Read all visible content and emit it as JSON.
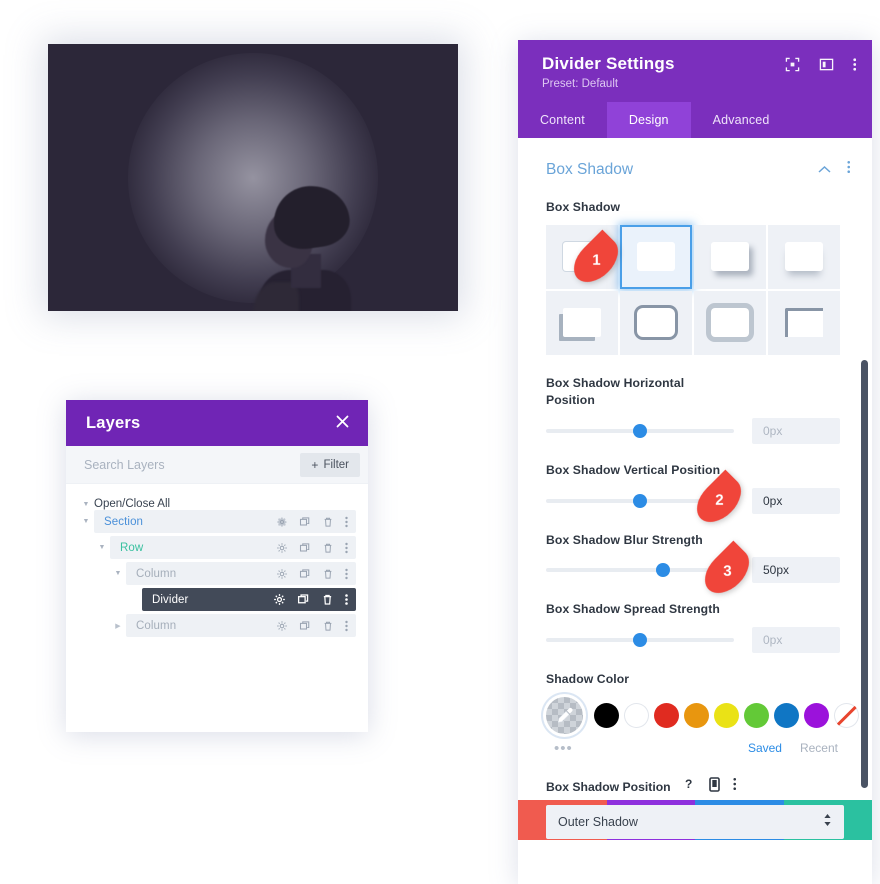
{
  "canvas": {
    "name": "divider-preview-canvas",
    "background_color": "#2c2739",
    "glow_color": "#ebebf5"
  },
  "layers_panel": {
    "title": "Layers",
    "close_icon": "close-icon",
    "search_placeholder": "Search Layers",
    "search_value": "",
    "filter_label": "Filter",
    "filter_icon": "plus-icon",
    "open_close_all": "Open/Close All",
    "row_icons": [
      "gear-icon",
      "duplicate-icon",
      "trash-icon",
      "kebab-icon"
    ],
    "rows": [
      {
        "label": "Section",
        "depth": 0,
        "caret": "down",
        "selected": false,
        "color": "#4a90d9"
      },
      {
        "label": "Row",
        "depth": 1,
        "caret": "down",
        "selected": false,
        "color": "#3ac1a0"
      },
      {
        "label": "Column",
        "depth": 2,
        "caret": "down",
        "selected": false,
        "color": "#a5aeba"
      },
      {
        "label": "Divider",
        "depth": 3,
        "caret": "none",
        "selected": true,
        "color": "#ffffff"
      },
      {
        "label": "Column",
        "depth": 2,
        "caret": "right",
        "selected": false,
        "color": "#a5aeba"
      }
    ]
  },
  "settings_panel": {
    "title": "Divider Settings",
    "preset": "Preset: Default",
    "header_icons": [
      "focus-icon",
      "layout-panel-icon",
      "kebab-icon"
    ],
    "tabs": [
      {
        "label": "Content",
        "active": false
      },
      {
        "label": "Design",
        "active": true
      },
      {
        "label": "Advanced",
        "active": false
      }
    ],
    "section": {
      "title": "Box Shadow",
      "collapse_icon": "chevron-up-icon",
      "menu_icon": "kebab-icon"
    },
    "box_shadow": {
      "label": "Box Shadow",
      "selected_index": 1,
      "presets": [
        "none-preset",
        "glow-preset",
        "offset-preset",
        "bottom-preset",
        "corner-preset",
        "outline-preset",
        "soft-preset",
        "top-left-preset"
      ]
    },
    "fields": [
      {
        "label": "Box Shadow Horizontal Position",
        "value": "0px",
        "filled": false,
        "thumb_pct": 50
      },
      {
        "label": "Box Shadow Vertical Position",
        "value": "0px",
        "filled": true,
        "thumb_pct": 50
      },
      {
        "label": "Box Shadow Blur Strength",
        "value": "50px",
        "filled": true,
        "thumb_pct": 62
      },
      {
        "label": "Box Shadow Spread Strength",
        "value": "0px",
        "filled": false,
        "thumb_pct": 50
      }
    ],
    "shadow_color": {
      "label": "Shadow Color",
      "picker_icon": "eyedropper-icon",
      "swatches": [
        {
          "name": "black",
          "hex": "#000000"
        },
        {
          "name": "white",
          "hex": "#ffffff"
        },
        {
          "name": "red",
          "hex": "#e02b20"
        },
        {
          "name": "orange",
          "hex": "#e8960f"
        },
        {
          "name": "yellow",
          "hex": "#eae216"
        },
        {
          "name": "green",
          "hex": "#63c937"
        },
        {
          "name": "blue",
          "hex": "#1076c4"
        },
        {
          "name": "purple",
          "hex": "#9b12db"
        },
        {
          "name": "none",
          "hex": "#ffffff"
        }
      ],
      "more_icon": "ellipsis-icon",
      "saved_label": "Saved",
      "recent_label": "Recent"
    },
    "position_field": {
      "label": "Box Shadow Position",
      "help_icon": "question-icon",
      "device_icon": "mobile-icon",
      "menu_icon": "kebab-icon",
      "value": "Outer Shadow",
      "arrows_icon": "updown-arrows-icon"
    },
    "footer_buttons": [
      {
        "name": "cancel-button",
        "icon": "close-icon",
        "color": "#f05b4f"
      },
      {
        "name": "undo-button",
        "icon": "undo-icon",
        "color": "#8e30dd"
      },
      {
        "name": "redo-button",
        "icon": "redo-icon",
        "color": "#2c8ce5"
      },
      {
        "name": "save-button",
        "icon": "checkmark-icon",
        "color": "#2bc1a0"
      }
    ]
  },
  "callouts": [
    {
      "number": "1"
    },
    {
      "number": "2"
    },
    {
      "number": "3"
    }
  ]
}
